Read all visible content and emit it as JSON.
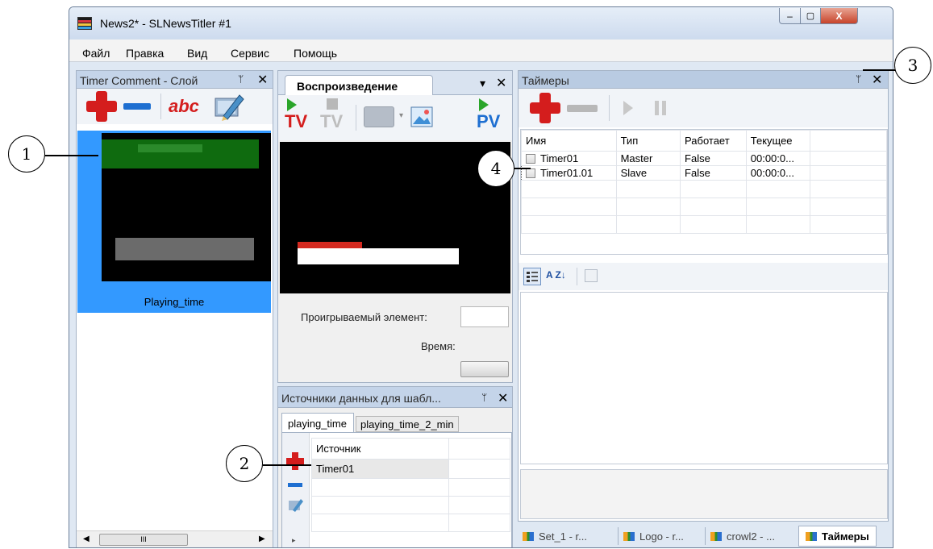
{
  "window": {
    "title": "News2* - SLNewsTitler #1",
    "controls": {
      "minimize": "–",
      "maximize": "▢",
      "close": "X"
    }
  },
  "menu": [
    "Файл",
    "Правка",
    "Вид",
    "Сервис",
    "Помощь"
  ],
  "layer_panel": {
    "title": "Timer Comment - Слой",
    "pin": "ᛘ",
    "close": "✕",
    "text_tool": "abc",
    "item_label": "Playing_time",
    "scroll_grip": "III"
  },
  "playback_panel": {
    "tab": "Воспроизведение",
    "dropdown": "▾",
    "close": "✕",
    "tv_label": "TV",
    "tv_label_disabled": "TV",
    "pv_label": "PV",
    "playing_element_label": "Проигрываемый элемент:",
    "time_label": "Время:"
  },
  "sources_panel": {
    "title": "Источники данных для шабл...",
    "pin": "ᛘ",
    "close": "✕",
    "tabs": [
      "playing_time",
      "playing_time_2_min"
    ],
    "column": "Источник",
    "rows": [
      "Timer01"
    ]
  },
  "timers_panel": {
    "title": "Таймеры",
    "pin": "ᛘ",
    "close": "✕",
    "columns": [
      "Имя",
      "Тип",
      "Работает",
      "Текущее"
    ],
    "rows": [
      {
        "name": "Timer01",
        "type": "Master",
        "running": "False",
        "current": "00:00:0..."
      },
      {
        "name": "Timer01.01",
        "type": "Slave",
        "running": "False",
        "current": "00:00:0..."
      }
    ],
    "sort_label": "A Z↓"
  },
  "doc_tabs": [
    "Set_1 - r...",
    "Logo - r...",
    "crowl2 - ...",
    "Таймеры"
  ],
  "callouts": [
    "1",
    "2",
    "3",
    "4"
  ],
  "colors": {
    "accent_red": "#d41d1d",
    "accent_blue": "#1e6fd1",
    "selection": "#3399ff",
    "panel_header": "#c4d4e9",
    "thumb_green": "#0f6b0f",
    "thumb_red": "#d42a20"
  }
}
